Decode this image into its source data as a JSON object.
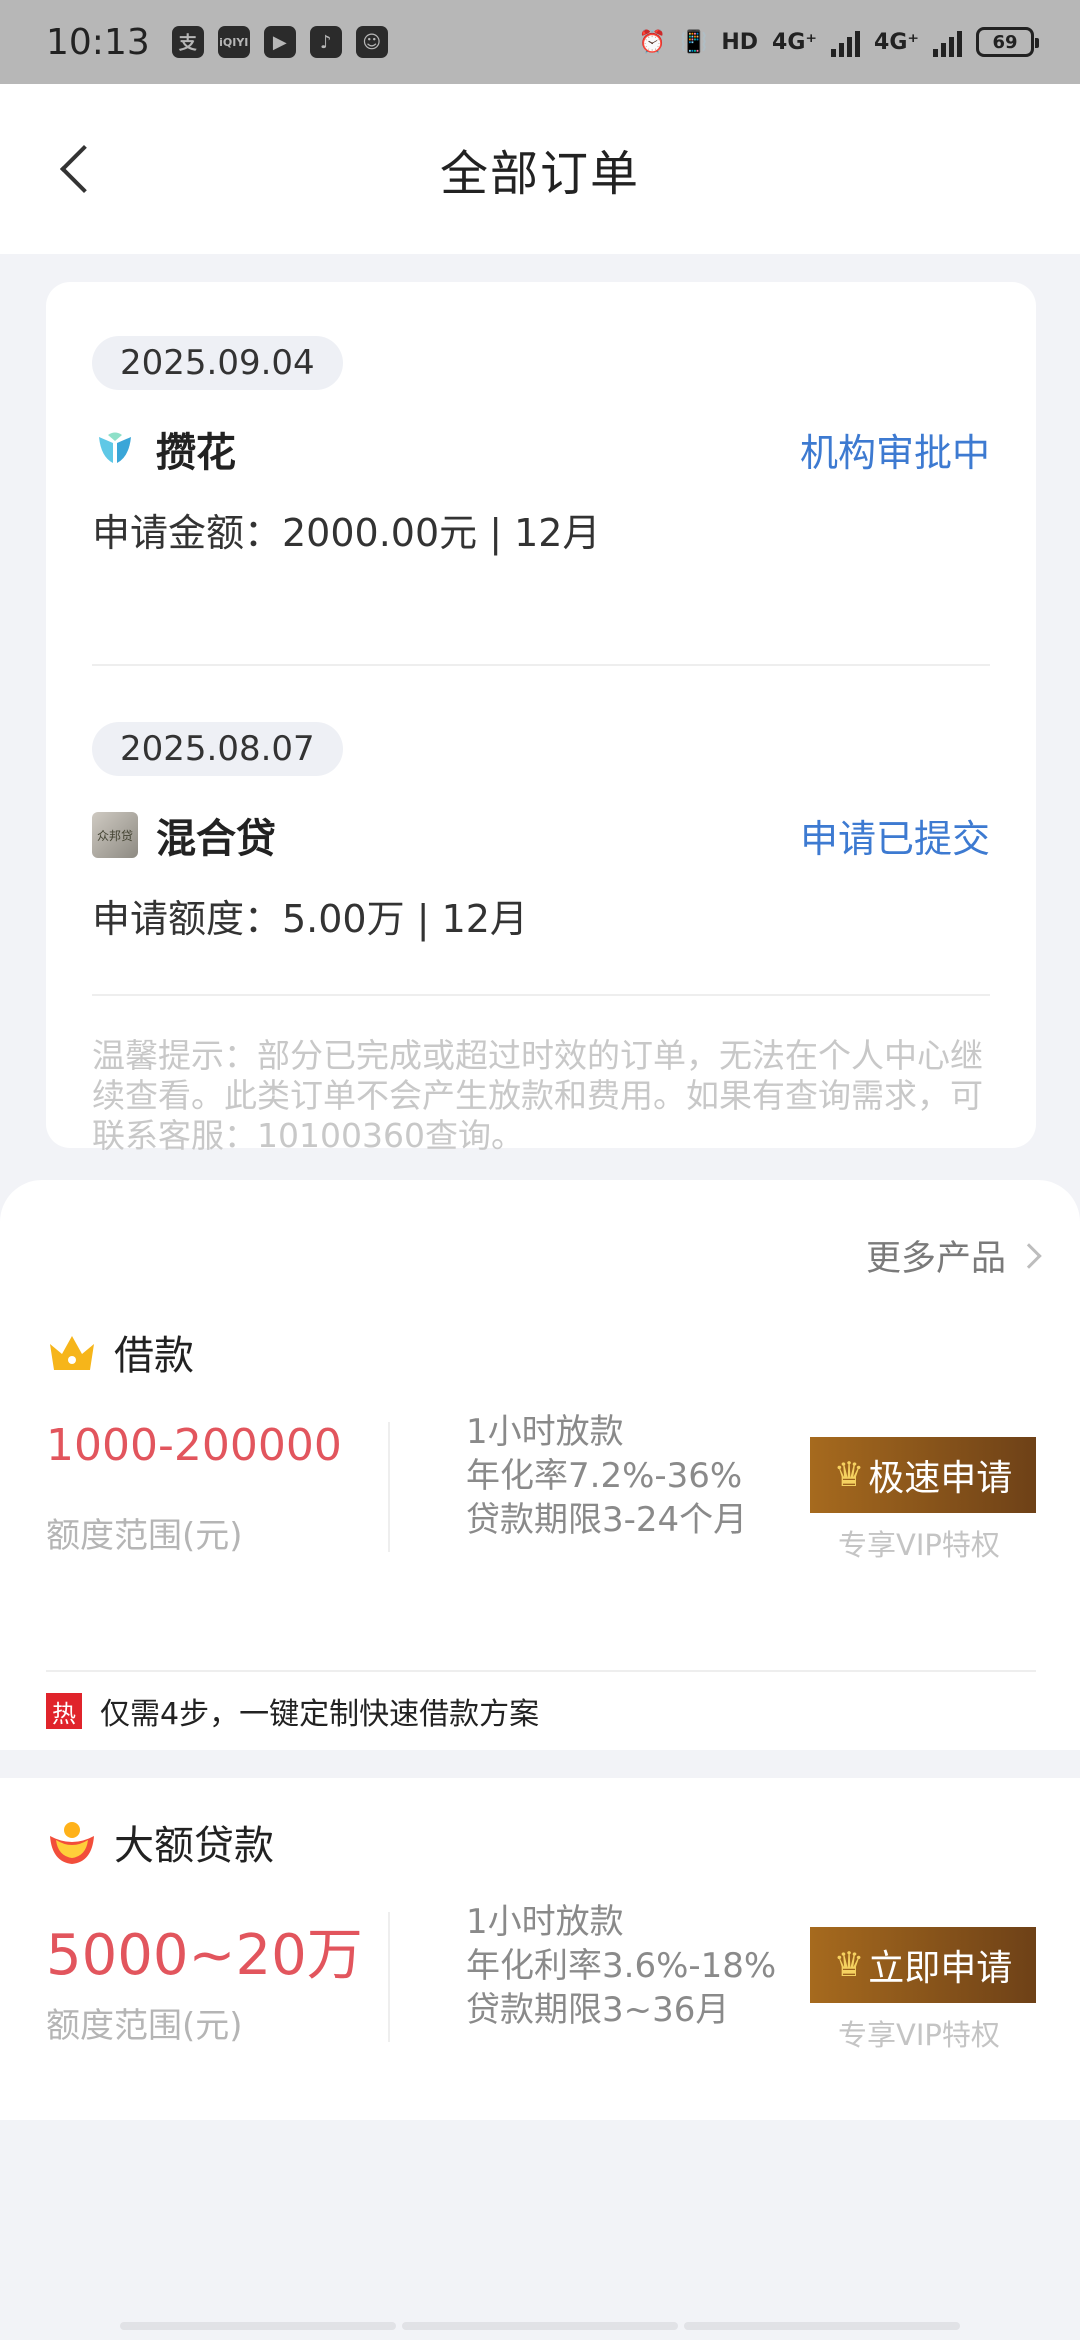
{
  "status_bar": {
    "time": "10:13",
    "app_icons": [
      "支",
      "iQIYI",
      "▶",
      "♪",
      "☺"
    ],
    "indicators": [
      "HD",
      "4G⁺",
      "4G⁺"
    ],
    "battery": "69"
  },
  "header": {
    "title": "全部订单"
  },
  "orders": [
    {
      "date": "2025.09.04",
      "logo_icon": "leaf-logo-icon",
      "product": "攒花",
      "status": "机构审批中",
      "amount": "申请金额：2000.00元 | 12月"
    },
    {
      "date": "2025.08.07",
      "logo_icon": "product-thumbnail-icon",
      "logo_text": "众邦贷",
      "product": "混合贷",
      "status": "申请已提交",
      "amount": "申请额度：5.00万 | 12月"
    }
  ],
  "tips": "温馨提示：部分已完成或超过时效的订单，无法在个人中心继续查看。此类订单不会产生放款和费用。如果有查询需求，可联系客服：10100360查询。",
  "more_products": "更多产品",
  "products": [
    {
      "icon": "crown-icon",
      "name": "借款",
      "range": "1000-200000",
      "range_label": "额度范围(元)",
      "features": [
        "1小时放款",
        "年化率7.2%-36%",
        "贷款期限3-24个月"
      ],
      "button": "极速申请",
      "vip": "专享VIP特权"
    },
    {
      "icon": "gold-ingot-icon",
      "name": "大额贷款",
      "range": "5000~20万",
      "range_label": "额度范围(元)",
      "features": [
        "1小时放款",
        "年化利率3.6%-18%",
        "贷款期限3~36月"
      ],
      "button": "立即申请",
      "vip": "专享VIP特权"
    }
  ],
  "hot": {
    "badge": "热",
    "text": "仅需4步，一键定制快速借款方案"
  },
  "colors": {
    "accent_blue": "#3d7ad1",
    "range_red": "#e2555d",
    "button_brown": "#8a561b",
    "hot_red": "#e0242b"
  }
}
